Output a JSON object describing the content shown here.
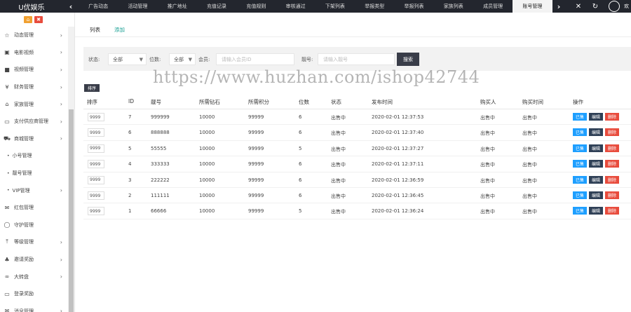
{
  "app": {
    "title": "U优娱乐"
  },
  "topbar": {
    "tabs": [
      "广告动态",
      "活动管理",
      "推广地址",
      "充值记录",
      "充值规则",
      "审核通过",
      "下架列表",
      "举报类型",
      "举报列表",
      "家族列表",
      "成员管理",
      "账号管理"
    ],
    "active_tab": "账号管理",
    "avatar_text": "欢"
  },
  "sidebar": {
    "items": [
      {
        "label": "动态管理",
        "icon": "star-icon",
        "glyph": "☆",
        "arrow": true,
        "sub": false
      },
      {
        "label": "电影视频",
        "icon": "film-icon",
        "glyph": "▣",
        "arrow": true,
        "sub": false
      },
      {
        "label": "视频管理",
        "icon": "video-icon",
        "glyph": "■",
        "arrow": true,
        "sub": false
      },
      {
        "label": "财务管理",
        "icon": "yen-icon",
        "glyph": "¥",
        "arrow": true,
        "sub": false
      },
      {
        "label": "家族管理",
        "icon": "bank-icon",
        "glyph": "⌂",
        "arrow": true,
        "sub": false
      },
      {
        "label": "支付供应商管理",
        "icon": "monitor-icon",
        "glyph": "▭",
        "arrow": true,
        "sub": false
      },
      {
        "label": "商城管理",
        "icon": "cart-icon",
        "glyph": "⛟",
        "arrow": true,
        "sub": false
      },
      {
        "label": "小号管理",
        "icon": "dot-icon",
        "glyph": "•",
        "arrow": false,
        "sub": true
      },
      {
        "label": "靓号管理",
        "icon": "dot-icon",
        "glyph": "•",
        "arrow": false,
        "sub": true
      },
      {
        "label": "VIP管理",
        "icon": "dot-icon",
        "glyph": "•",
        "arrow": true,
        "sub": true
      },
      {
        "label": "红包管理",
        "icon": "envelope-icon",
        "glyph": "✉",
        "arrow": false,
        "sub": false
      },
      {
        "label": "守护管理",
        "icon": "shield-icon",
        "glyph": "◯",
        "arrow": false,
        "sub": false
      },
      {
        "label": "等级管理",
        "icon": "level-icon",
        "glyph": "⤒",
        "arrow": true,
        "sub": false
      },
      {
        "label": "邀请奖励",
        "icon": "sitemap-icon",
        "glyph": "♣",
        "arrow": true,
        "sub": false
      },
      {
        "label": "大转盘",
        "icon": "wheel-icon",
        "glyph": "∞",
        "arrow": true,
        "sub": false
      },
      {
        "label": "登录奖励",
        "icon": "desktop-icon",
        "glyph": "▭",
        "arrow": false,
        "sub": false
      },
      {
        "label": "消息管理",
        "icon": "message-icon",
        "glyph": "✉",
        "arrow": true,
        "sub": false
      }
    ]
  },
  "subtabs": {
    "list": "列表",
    "add": "添加"
  },
  "filter": {
    "status_label": "状态:",
    "status_value": "全部",
    "digits_label": "位数:",
    "digits_value": "全部",
    "member_label": "会员:",
    "member_placeholder": "请输入会员ID",
    "account_label": "靓号:",
    "account_placeholder": "请输入靓号",
    "search_button": "搜索"
  },
  "sort_button": "排序",
  "table": {
    "headers": [
      "排序",
      "ID",
      "靓号",
      "所需钻石",
      "所需积分",
      "位数",
      "状态",
      "发布时间",
      "购买人",
      "购买时间",
      "操作"
    ],
    "rows": [
      {
        "sort": "9999",
        "id": "7",
        "number": "999999",
        "diamond": "10000",
        "points": "99999",
        "digits": "6",
        "status": "出售中",
        "time": "2020-02-01 12:37:53",
        "buyer": "出售中",
        "buy_time": "出售中"
      },
      {
        "sort": "9999",
        "id": "6",
        "number": "888888",
        "diamond": "10000",
        "points": "99999",
        "digits": "6",
        "status": "出售中",
        "time": "2020-02-01 12:37:40",
        "buyer": "出售中",
        "buy_time": "出售中"
      },
      {
        "sort": "9999",
        "id": "5",
        "number": "55555",
        "diamond": "10000",
        "points": "99999",
        "digits": "5",
        "status": "出售中",
        "time": "2020-02-01 12:37:27",
        "buyer": "出售中",
        "buy_time": "出售中"
      },
      {
        "sort": "9999",
        "id": "4",
        "number": "333333",
        "diamond": "10000",
        "points": "99999",
        "digits": "6",
        "status": "出售中",
        "time": "2020-02-01 12:37:11",
        "buyer": "出售中",
        "buy_time": "出售中"
      },
      {
        "sort": "9999",
        "id": "3",
        "number": "222222",
        "diamond": "10000",
        "points": "99999",
        "digits": "6",
        "status": "出售中",
        "time": "2020-02-01 12:36:59",
        "buyer": "出售中",
        "buy_time": "出售中"
      },
      {
        "sort": "9999",
        "id": "2",
        "number": "111111",
        "diamond": "10000",
        "points": "99999",
        "digits": "6",
        "status": "出售中",
        "time": "2020-02-01 12:36:45",
        "buyer": "出售中",
        "buy_time": "出售中"
      },
      {
        "sort": "9999",
        "id": "1",
        "number": "66666",
        "diamond": "10000",
        "points": "99999",
        "digits": "5",
        "status": "出售中",
        "time": "2020-02-01 12:36:24",
        "buyer": "出售中",
        "buy_time": "出售中"
      }
    ],
    "ops": {
      "sold": "已售",
      "edit": "编辑",
      "delete": "删除"
    }
  },
  "watermark": "https://www.huzhan.com/ishop42744",
  "colors": {
    "topbar": "#23262e",
    "accent": "#1aa094",
    "primary_button": "#393d49",
    "blue": "#1e9fff",
    "red": "#e84c3d"
  }
}
